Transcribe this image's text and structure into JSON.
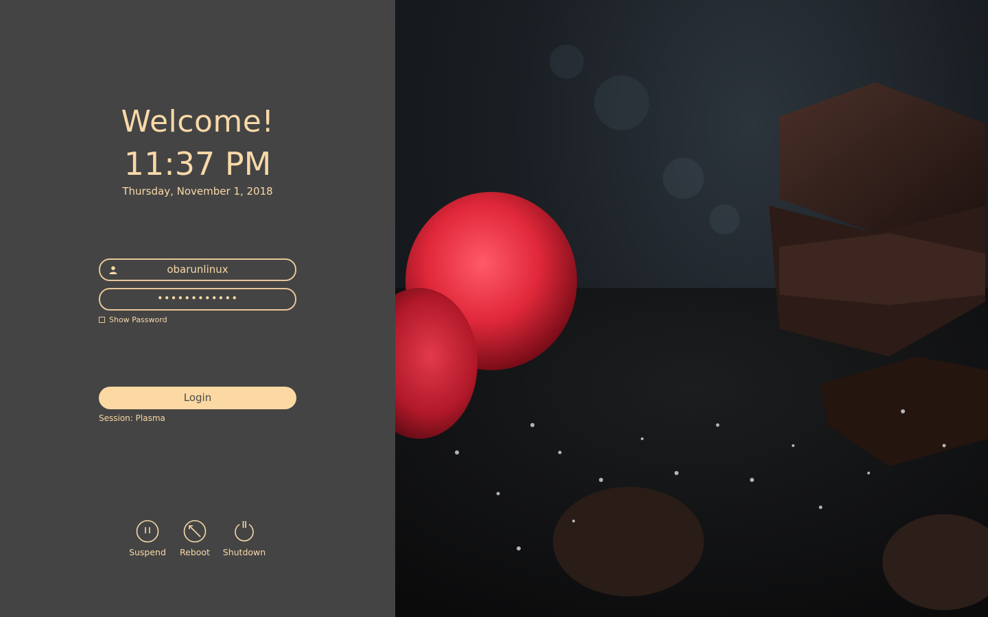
{
  "greeting": "Welcome!",
  "clock": {
    "time": "11:37 PM",
    "date": "Thursday, November 1, 2018"
  },
  "login": {
    "username": "obarunlinux",
    "password_masked": "••••••••••••",
    "show_password_label": "Show Password",
    "login_label": "Login",
    "session_label": "Session: Plasma"
  },
  "power": {
    "suspend_label": "Suspend",
    "reboot_label": "Reboot",
    "shutdown_label": "Shutdown"
  },
  "colors": {
    "panel_bg": "#444444",
    "accent": "#fcd9a3",
    "text": "#f8d9a8"
  },
  "wallpaper": {
    "subject": "raspberries and dark chocolate pieces"
  }
}
